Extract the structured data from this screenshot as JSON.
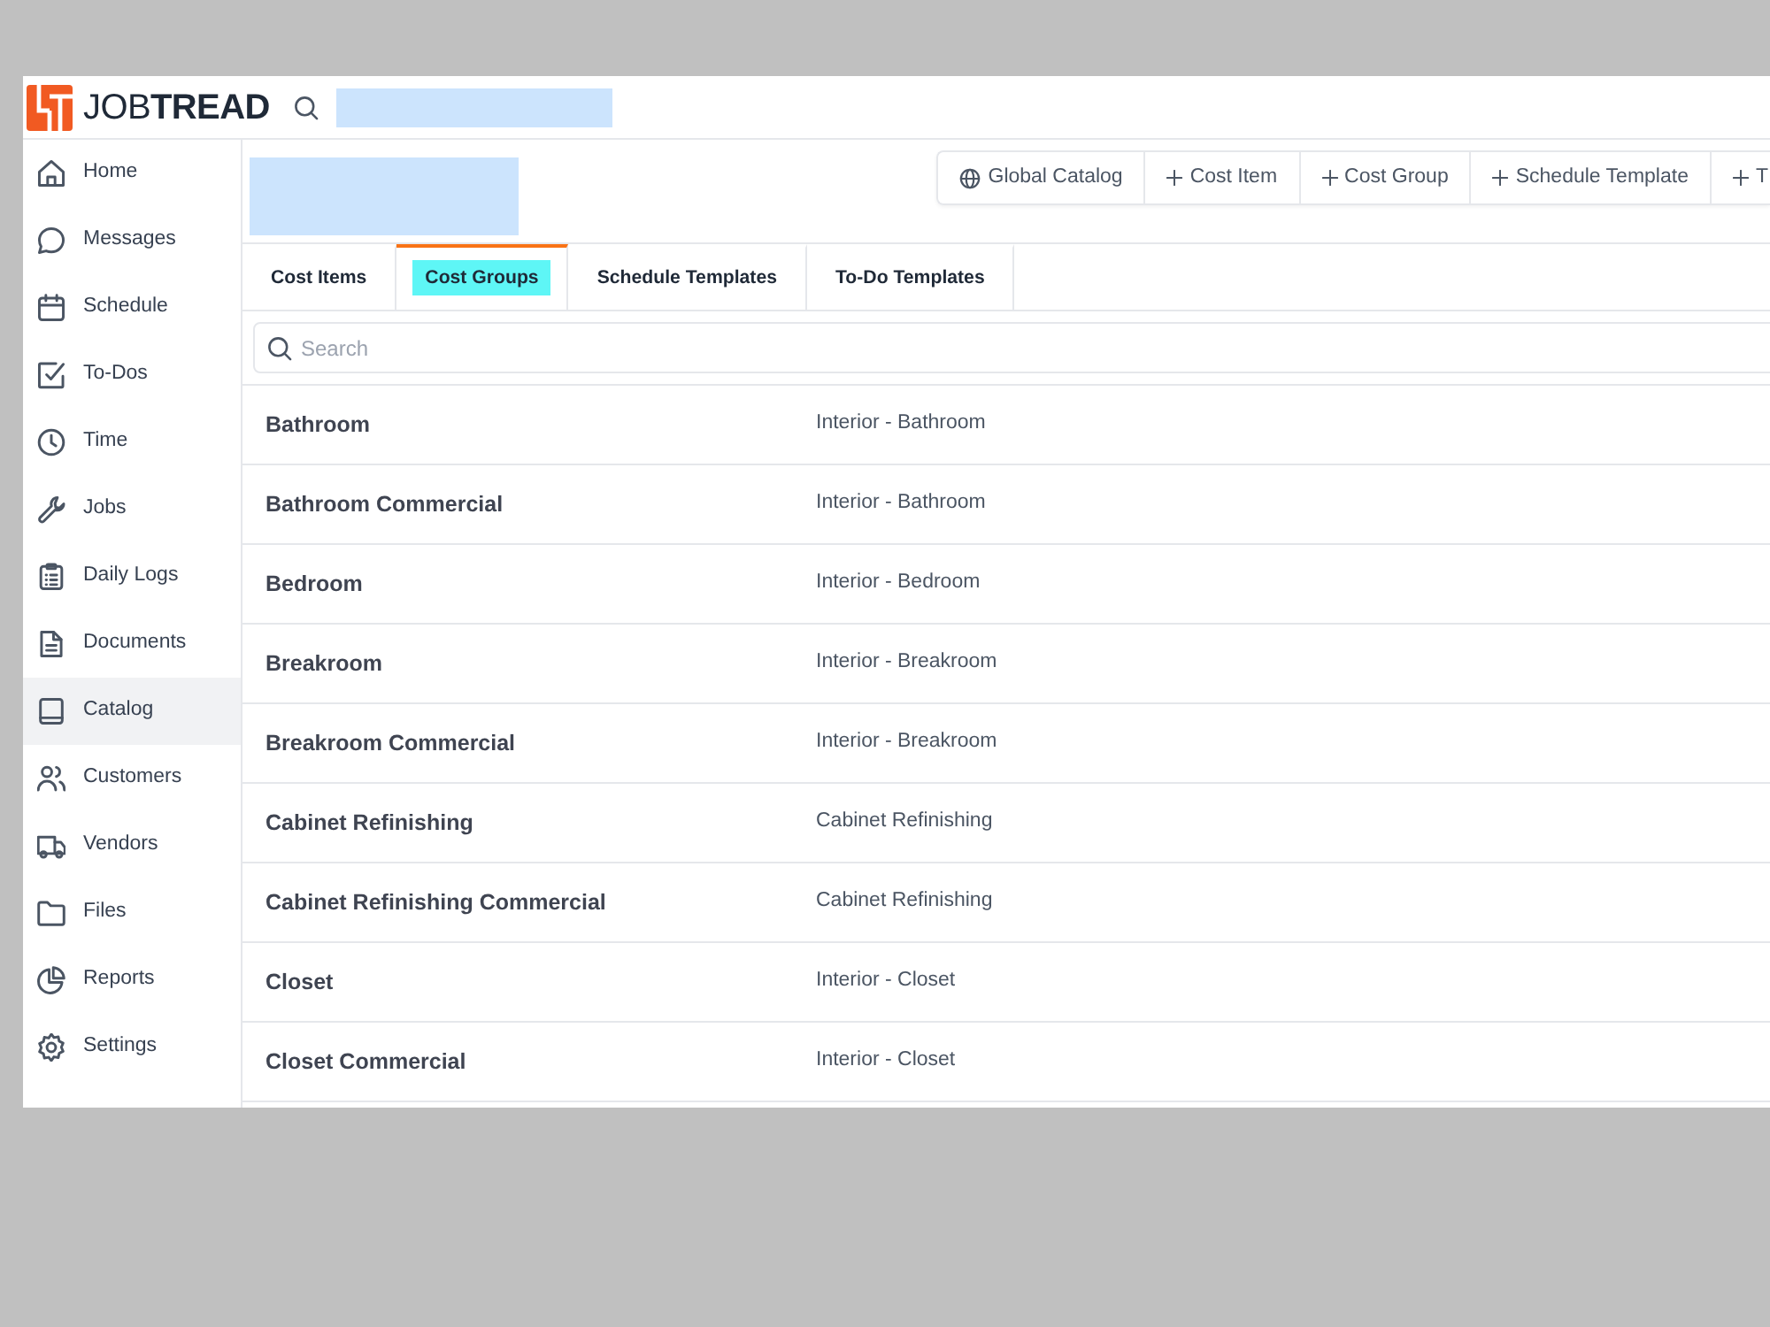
{
  "top_bar": {
    "logo": "JOB**TREAD**"
  },
  "sidebar": {
    "items": [
      {
        "label": "Home",
        "selected": false
      },
      {
        "label": "Messages",
        "selected": false
      },
      {
        "label": "Schedule",
        "selected": false
      },
      {
        "label": "To-Dos",
        "selected": false
      },
      {
        "label": "Time",
        "selected": false
      },
      {
        "label": "Jobs",
        "selected": false
      },
      {
        "label": "Daily Logs",
        "selected": false
      },
      {
        "label": "Documents",
        "selected": false
      },
      {
        "label": "Catalog",
        "selected": true
      },
      {
        "label": "Customers",
        "selected": false
      },
      {
        "label": "Vendors",
        "selected": false
      },
      {
        "label": "Files",
        "selected": false
      },
      {
        "label": "Reports",
        "selected": false
      },
      {
        "label": "Settings",
        "selected": false
      }
    ]
  },
  "header": {
    "buttons": [
      {
        "kind": "browse",
        "label": "Global Catalog"
      },
      {
        "kind": "add",
        "label": "Cost Item"
      },
      {
        "kind": "add",
        "label": "Cost Group"
      },
      {
        "kind": "add",
        "label": "Schedule Template"
      },
      {
        "kind": "add",
        "label": "T"
      }
    ]
  },
  "tabs": [
    {
      "label": "Cost Items",
      "selected": false
    },
    {
      "label": "Cost Groups",
      "selected": true
    },
    {
      "label": "Schedule Templates",
      "selected": false
    },
    {
      "label": "To-Do Templates",
      "selected": false
    }
  ],
  "search": {
    "placeholder": "Search"
  },
  "cost_groups": [
    {
      "name": "Bathroom",
      "category": "Interior - Bathroom"
    },
    {
      "name": "Bathroom Commercial",
      "category": "Interior - Bathroom"
    },
    {
      "name": "Bedroom",
      "category": "Interior - Bedroom"
    },
    {
      "name": "Breakroom",
      "category": "Interior - Breakroom"
    },
    {
      "name": "Breakroom Commercial",
      "category": "Interior - Breakroom"
    },
    {
      "name": "Cabinet Refinishing",
      "category": "Cabinet Refinishing"
    },
    {
      "name": "Cabinet Refinishing Commercial",
      "category": "Cabinet Refinishing"
    },
    {
      "name": "Closet",
      "category": "Interior - Closet"
    },
    {
      "name": "Closet Commercial",
      "category": "Interior - Closet"
    }
  ]
}
